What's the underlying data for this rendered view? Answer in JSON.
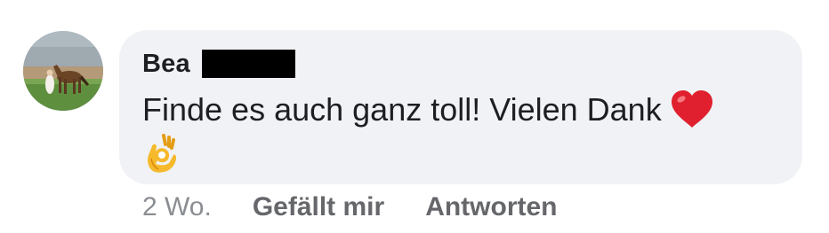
{
  "comment": {
    "author": "Bea",
    "text": "Finde es auch ganz toll! Vielen Dank",
    "emojis": [
      "red-heart-icon",
      "ok-hand-icon"
    ],
    "timestamp": "2 Wo.",
    "like_label": "Gefällt mir",
    "reply_label": "Antworten"
  },
  "colors": {
    "bubble": "#f0f2f5",
    "text": "#1c1e21",
    "meta": "#65676b",
    "heart": "#e0202e",
    "ok_hand": "#f6b92b"
  }
}
